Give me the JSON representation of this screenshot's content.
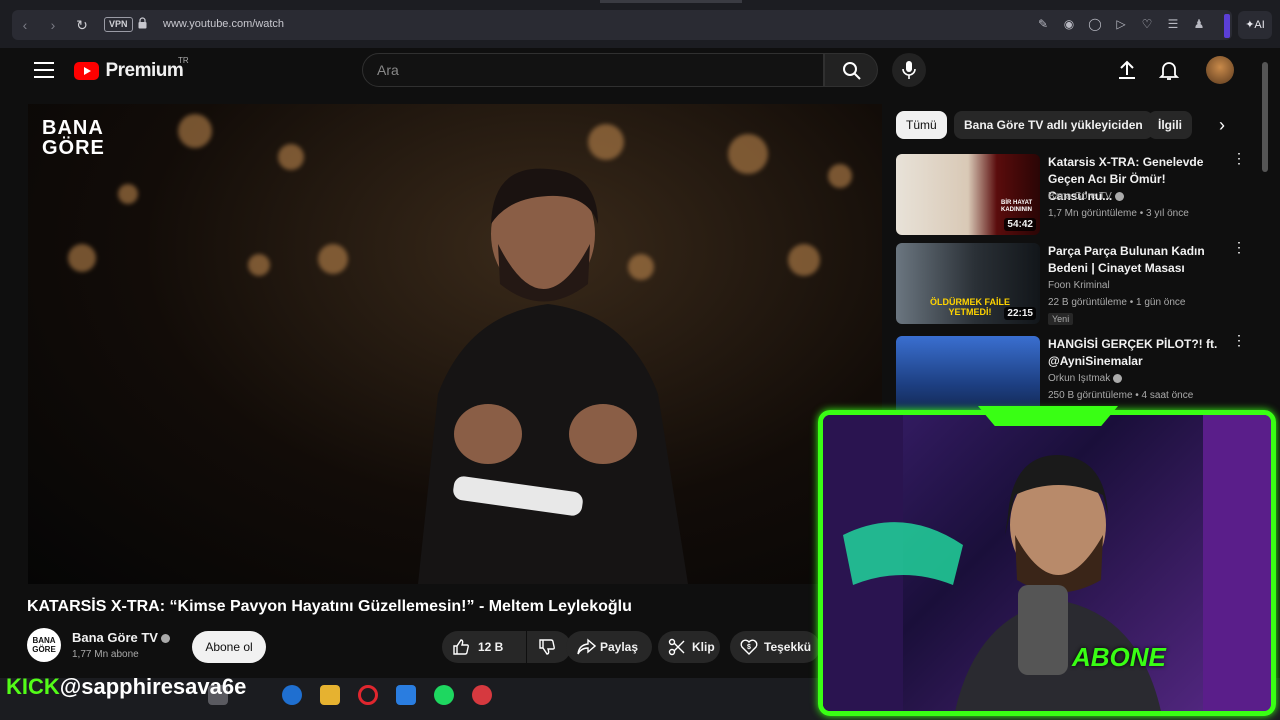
{
  "browser": {
    "vpn_label": "VPN",
    "url": "www.youtube.com/watch",
    "ai_label": "AI",
    "accent": "#5b3fd6"
  },
  "youtube": {
    "brand": "Premium",
    "region": "TR",
    "search_placeholder": "Ara",
    "accent": "#ff0000"
  },
  "video": {
    "watermark_line1": "BANA",
    "watermark_line2": "GÖRE",
    "title": "KATARSİS X-TRA: “Kimse Pavyon Hayatını Güzellemesin!” - Meltem Leylekoğlu",
    "channel_name": "Bana Göre TV",
    "channel_avatar_text": "BANA GÖRE",
    "subscribers": "1,77 Mn abone",
    "subscribe_label": "Abone ol",
    "likes": "12 B",
    "share_label": "Paylaş",
    "clip_label": "Klip",
    "thanks_label": "Teşekkü"
  },
  "chips": [
    {
      "label": "Tümü",
      "active": true
    },
    {
      "label": "Bana Göre TV adlı yükleyiciden",
      "active": false
    },
    {
      "label": "İlgili",
      "active": false
    }
  ],
  "recommendations": [
    {
      "title": "Katarsis X-TRA: Genelevde Geçen Acı Bir Ömür! Cansu'nu...",
      "channel": "Bana Göre TV",
      "meta": "1,7 Mn görüntüleme • 3 yıl önce",
      "duration": "54:42",
      "thumb_text": "BİR HAYAT KADINININ",
      "badge": ""
    },
    {
      "title": "Parça Parça Bulunan Kadın Bedeni | Cinayet Masası",
      "channel": "Foon Kriminal",
      "meta": "22 B görüntüleme • 1 gün önce",
      "duration": "22:15",
      "thumb_text": "ÖLDÜRMEK FAİLE YETMEDİ!",
      "badge": "Yeni"
    },
    {
      "title": "HANGİSİ GERÇEK PİLOT?! ft. @AyniSinemalar",
      "channel": "Orkun Işıtmak",
      "meta": "250 B görüntüleme • 4 saat önce",
      "duration": "",
      "thumb_text": "",
      "badge": ""
    }
  ],
  "stream": {
    "kick_label": "KICK",
    "handle": "@sapphiresava6e",
    "overlay_text": "ABONE",
    "accent": "#39ff14"
  }
}
